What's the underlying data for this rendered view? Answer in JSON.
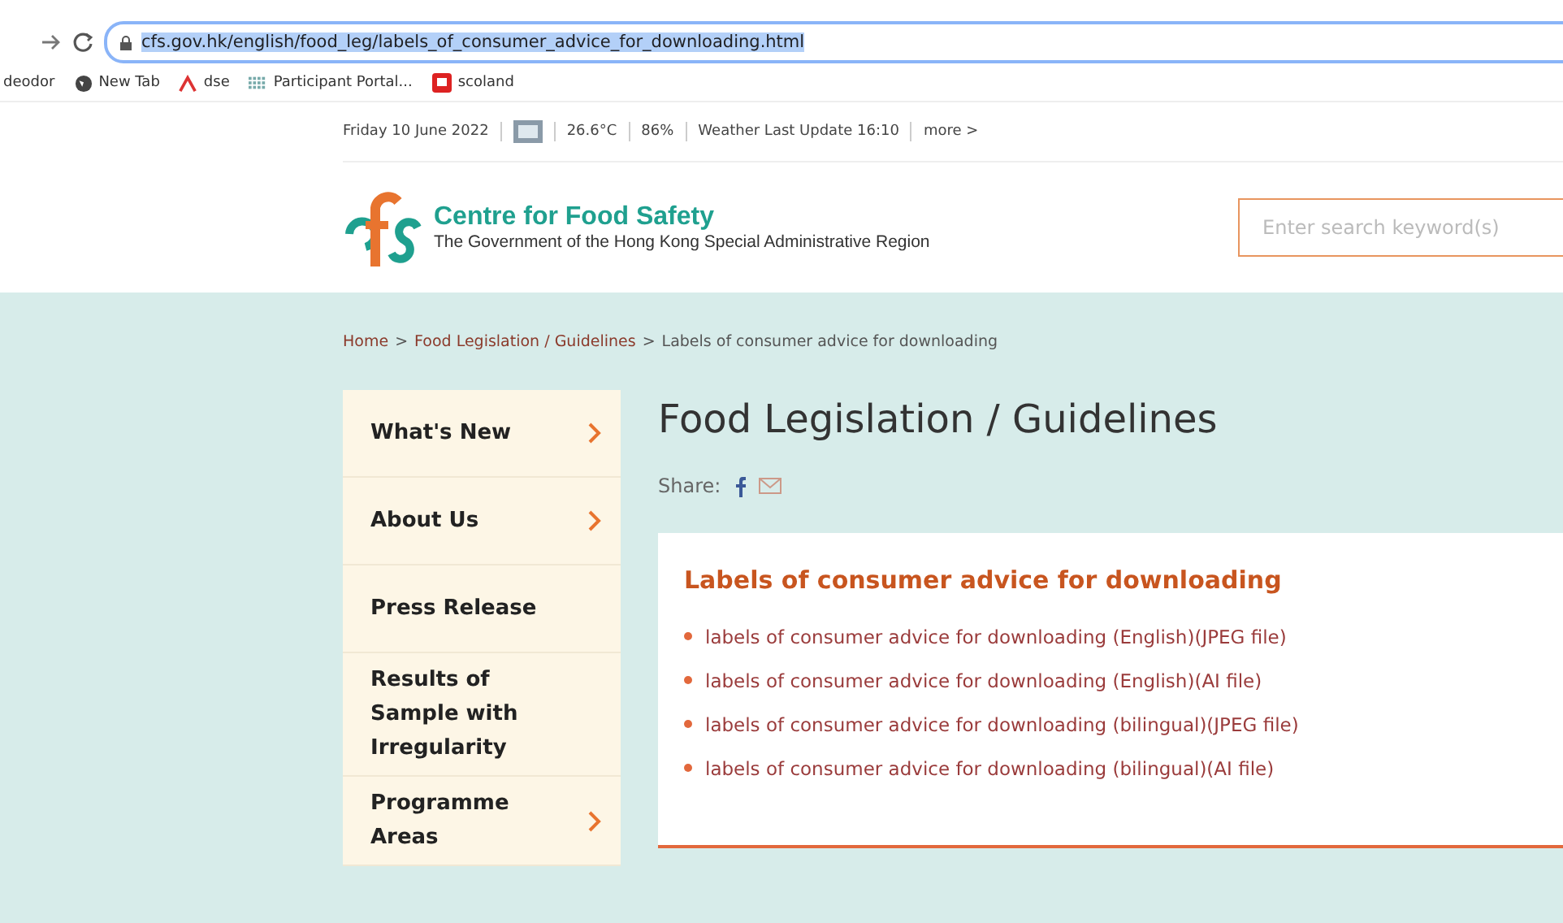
{
  "browser": {
    "url": "cfs.gov.hk/english/food_leg/labels_of_consumer_advice_for_downloading.html",
    "url_selected": true,
    "bookmarks": [
      {
        "label": "deodor",
        "kind": "plain"
      },
      {
        "label": "New Tab",
        "kind": "globe"
      },
      {
        "label": "dse",
        "kind": "caret"
      },
      {
        "label": "Participant Portal...",
        "kind": "grid"
      },
      {
        "label": "scoland",
        "kind": "square"
      }
    ]
  },
  "topbar": {
    "date": "Friday 10 June 2022",
    "temperature": "26.6°C",
    "humidity": "86%",
    "weather_update": "Weather Last Update 16:10",
    "more": "more >"
  },
  "header": {
    "site_name": "Centre for Food Safety",
    "subtitle": "The Government of the Hong Kong Special Administrative Region",
    "search": {
      "placeholder": "Enter search keyword(s)"
    }
  },
  "breadcrumb": [
    {
      "label": "Home",
      "link": true,
      "separator": ">"
    },
    {
      "label": "Food Legislation / Guidelines",
      "link": true,
      "separator": ">"
    },
    {
      "label": "Labels of consumer advice for downloading",
      "link": false
    }
  ],
  "sidebar": {
    "items": [
      {
        "label": "What's New",
        "has_submenu": true
      },
      {
        "label": "About Us",
        "has_submenu": true
      },
      {
        "label": "Press Release",
        "has_submenu": false
      },
      {
        "label": "Results of Sample with Irregularity",
        "has_submenu": false
      },
      {
        "label": "Programme Areas",
        "has_submenu": true
      }
    ]
  },
  "page_title": "Food Legislation / Guidelines",
  "share": {
    "label": "Share:"
  },
  "card": {
    "title": "Labels of consumer advice for downloading",
    "links": [
      "labels of consumer advice for downloading (English)(JPEG file)",
      "labels of consumer advice for downloading (English)(AI file)",
      "labels of consumer advice for downloading (bilingual)(JPEG file)",
      "labels of consumer advice for downloading (bilingual)(AI file)"
    ]
  }
}
